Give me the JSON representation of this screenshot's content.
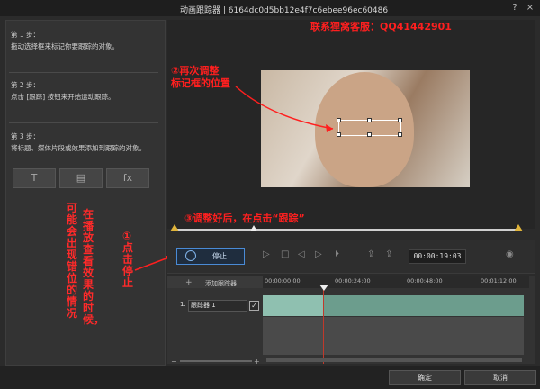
{
  "window": {
    "title": "动画跟踪器  |  6164dc0d5bb12e4f7c6ebee96ec60486",
    "help": "?",
    "close": "×"
  },
  "steps": [
    {
      "label": "第 1 步：",
      "text": "拖动选择框来标记你要跟踪的对象。"
    },
    {
      "label": "第 2 步：",
      "text": "点击 [跟踪] 按钮来开始运动跟踪。"
    },
    {
      "label": "第 3 步：",
      "text": "将标题、媒体片段或效果添加到跟踪的对象。"
    }
  ],
  "tools": {
    "text": "T",
    "media": "▤",
    "fx": "fx"
  },
  "annotations": {
    "contact": "联系狸窝客服：QQ41442901",
    "adjust_line1": "②再次调整",
    "adjust_line2": "标记框的位置",
    "after_adjust": "③调整好后，在点击“跟踪”",
    "click_stop": "①点击停止",
    "warning": "在播放查看效果的时候，可能会出现错位的情况"
  },
  "controls": {
    "stop_label": "停止",
    "timecode": "00:00:19:03"
  },
  "timeline": {
    "add_tracker": "添加跟踪器",
    "ruler": [
      "00:00:00:00",
      "00:00:24:00",
      "00:00:48:00",
      "00:01:12:00"
    ],
    "track_index": "1.",
    "track_name": "跟踪器 1",
    "checked": "✓"
  },
  "buttons": {
    "ok": "确定",
    "cancel": "取消"
  }
}
